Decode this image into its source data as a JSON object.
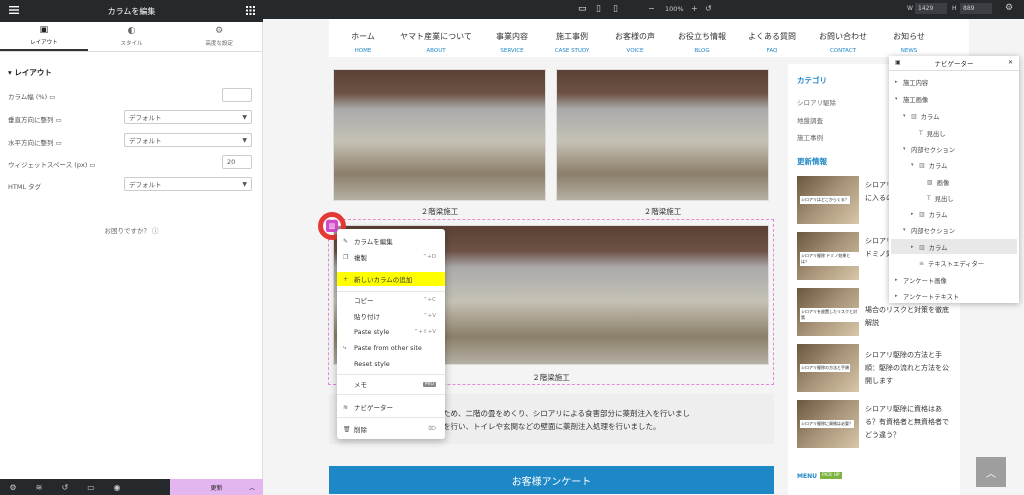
{
  "editor": {
    "panel_title": "カラムを編集",
    "tabs": [
      {
        "label": "レイアウト",
        "icon": "layout-icon"
      },
      {
        "label": "スタイル",
        "icon": "style-icon"
      },
      {
        "label": "高度な設定",
        "icon": "gear-icon"
      }
    ],
    "section_title": "レイアウト",
    "controls": [
      {
        "label": "カラム幅 (%)",
        "type": "number",
        "value": ""
      },
      {
        "label": "垂直方向に整列",
        "type": "select",
        "value": "デフォルト"
      },
      {
        "label": "水平方向に整列",
        "type": "select",
        "value": "デフォルト"
      },
      {
        "label": "ウィジェットスペース (px)",
        "type": "number",
        "value": "20"
      },
      {
        "label": "HTML タグ",
        "type": "select",
        "value": "デフォルト"
      }
    ],
    "help_text": "お困りですか？",
    "update_label": "更新"
  },
  "topbar": {
    "zoom": "100%",
    "width_label": "W",
    "width_value": "1429",
    "height_label": "H",
    "height_value": "889"
  },
  "site_nav": [
    {
      "jp": "ホーム",
      "en": "HOME"
    },
    {
      "jp": "ヤマト産業について",
      "en": "ABOUT"
    },
    {
      "jp": "事業内容",
      "en": "SERVICE"
    },
    {
      "jp": "施工事例",
      "en": "CASE STUDY"
    },
    {
      "jp": "お客様の声",
      "en": "VOICE"
    },
    {
      "jp": "お役立ち情報",
      "en": "BLOG"
    },
    {
      "jp": "よくある質問",
      "en": "FAQ"
    },
    {
      "jp": "お問い合わせ",
      "en": "CONTACT"
    },
    {
      "jp": "お知らせ",
      "en": "NEWS"
    }
  ],
  "captions": [
    "２階梁施工",
    "２階梁施工",
    "２階梁施工"
  ],
  "sidebar": {
    "category_title": "カテゴリ",
    "categories": [
      "シロアリ駆除",
      "地盤調査",
      "施工事例"
    ],
    "recent_title": "更新情報",
    "posts": [
      {
        "thumb": "シロアリはどこからくる？",
        "text": "シロアリはどこから家の中に入るのか？侵入を防ぐ実"
      },
      {
        "thumb": "シロアリ駆除 ドミノ効果とは？",
        "text": "シロアリ駆除の効果とは？ドミノ効果でできる"
      },
      {
        "thumb": "シロアリを放置したリスクと対策",
        "text": "場合のリスクと対策を徹底解説"
      },
      {
        "thumb": "シロアリ駆除の方法と手順",
        "text": "シロアリ駆除の方法と手順：駆除の流れと方法を公開します"
      },
      {
        "thumb": "シロアリ駆除に資格は必要？",
        "text": "シロアリ駆除に資格はある？有資格者と無資格者でどう違う？"
      }
    ],
    "menu_label": "MENU",
    "pickup_label": "PICK UP"
  },
  "body_text": [
    "見られたため、二階の畳をめくり、シロアリによる食害部分に薬剤注入を行いまし",
    "薬剤処理を行い、トイレや玄関などの壁面に薬剤注入処理を行いました。"
  ],
  "survey_label": "お客様アンケート",
  "context_menu": [
    {
      "label": "カラムを編集",
      "shortcut": "",
      "icon": "pencil-icon"
    },
    {
      "label": "複製",
      "shortcut": "⌃+D",
      "icon": "copy-icon"
    },
    {
      "label": "新しいカラムの追加",
      "shortcut": "",
      "icon": "plus-icon",
      "highlight": true
    },
    {
      "label": "コピー",
      "shortcut": "⌃+C",
      "icon": ""
    },
    {
      "label": "貼り付け",
      "shortcut": "⌃+V",
      "icon": ""
    },
    {
      "label": "Paste style",
      "shortcut": "⌃+⇧+V",
      "icon": ""
    },
    {
      "label": "Paste from other site",
      "shortcut": "",
      "icon": "paste-icon"
    },
    {
      "label": "Reset style",
      "shortcut": "",
      "icon": ""
    },
    {
      "label": "メモ",
      "shortcut": "PRO",
      "icon": ""
    },
    {
      "label": "ナビゲーター",
      "shortcut": "",
      "icon": "layers-icon"
    },
    {
      "label": "削除",
      "shortcut": "⌦",
      "icon": "trash-icon"
    }
  ],
  "navigator": {
    "title": "ナビゲーター",
    "items": [
      {
        "label": "施工内容",
        "indent": 0,
        "icon": "",
        "expanded": false
      },
      {
        "label": "施工画像",
        "indent": 0,
        "icon": "",
        "expanded": true
      },
      {
        "label": "カラム",
        "indent": 1,
        "icon": "column-icon",
        "expanded": true
      },
      {
        "label": "見出し",
        "indent": 2,
        "icon": "heading-icon",
        "expanded": null
      },
      {
        "label": "内部セクション",
        "indent": 1,
        "icon": "",
        "expanded": true
      },
      {
        "label": "カラム",
        "indent": 2,
        "icon": "column-icon",
        "expanded": true
      },
      {
        "label": "画像",
        "indent": 3,
        "icon": "image-icon",
        "expanded": null
      },
      {
        "label": "見出し",
        "indent": 3,
        "icon": "heading-icon",
        "expanded": null
      },
      {
        "label": "カラム",
        "indent": 2,
        "icon": "column-icon",
        "expanded": false
      },
      {
        "label": "内部セクション",
        "indent": 1,
        "icon": "",
        "expanded": true
      },
      {
        "label": "カラム",
        "indent": 2,
        "icon": "column-icon",
        "expanded": false,
        "selected": true
      },
      {
        "label": "テキストエディター",
        "indent": 2,
        "icon": "text-icon",
        "expanded": null
      },
      {
        "label": "アンケート画像",
        "indent": 0,
        "icon": "",
        "expanded": false
      },
      {
        "label": "アンケートテキスト",
        "indent": 0,
        "icon": "",
        "expanded": false
      }
    ]
  }
}
